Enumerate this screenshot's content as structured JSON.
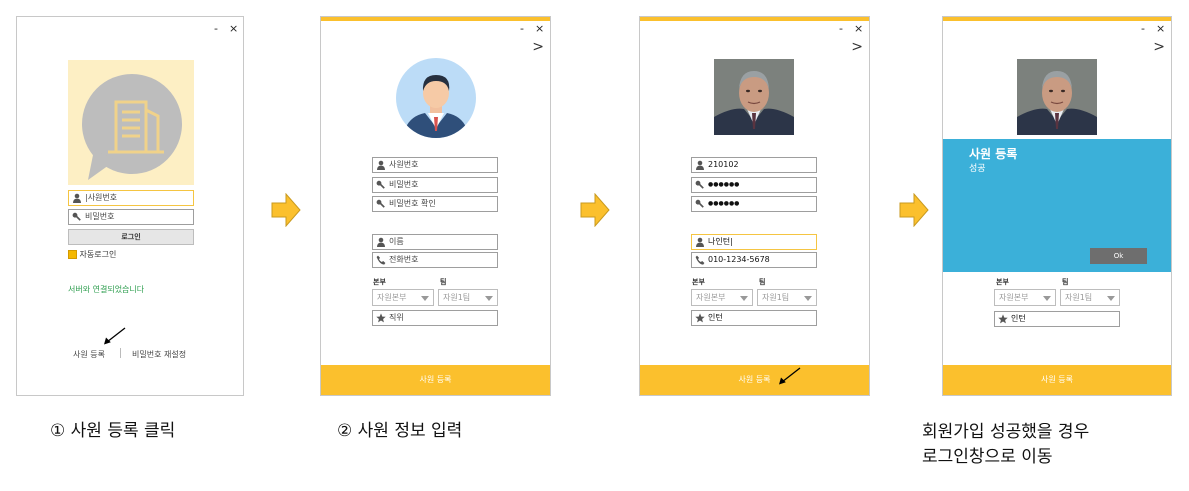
{
  "colors": {
    "accent": "#fbc02d",
    "success_panel": "#3bb0d9",
    "success_text": "#2e9e4f"
  },
  "common": {
    "minimize": "-",
    "close": "×",
    "next": ">",
    "id_ph": "사원번호",
    "pw_ph": "비밀번호",
    "pw_confirm_ph": "비밀번호 확인",
    "name_ph": "이름",
    "phone_ph": "전화번호",
    "dept_label": "본부",
    "team_label": "팀",
    "dept_default": "자원본부",
    "team_default": "자원1팀",
    "position_ph": "직위",
    "register_button": "사원 등록"
  },
  "login": {
    "id_placeholder": "|사원번호",
    "pw_placeholder": "비밀번호",
    "login_button": "로그인",
    "auto_login": "자동로그인",
    "status": "서버와 연결되었습니다",
    "register_link": "사원 등록",
    "reset_link": "비밀번호 재설정"
  },
  "filled": {
    "id": "210102",
    "pw": "●●●●●●",
    "pw_confirm": "●●●●●●",
    "name": "나인턴|",
    "phone": "010-1234-5678",
    "position": "인턴"
  },
  "success": {
    "title": "사원 등록",
    "subtitle": "성공",
    "ok_button": "Ok"
  },
  "captions": {
    "step1": "① 사원 등록 클릭",
    "step2": "② 사원 정보 입력",
    "note_line1": "회원가입 성공했을 경우",
    "note_line2": "로그인창으로 이동"
  }
}
